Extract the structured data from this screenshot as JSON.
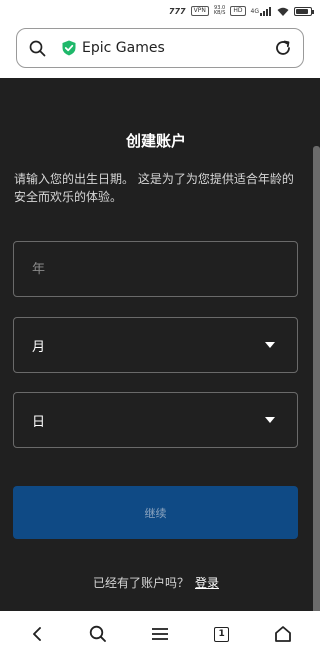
{
  "status_bar": {
    "carrier_glyph": "777",
    "vpn": "VPN",
    "speed_value": "93.0",
    "speed_unit": "KB/S",
    "hd": "HD",
    "network": "4G"
  },
  "address_bar": {
    "site_name": "Epic Games",
    "secure_color": "#1fb86a"
  },
  "form": {
    "title": "创建账户",
    "description": "请输入您的出生日期。 这是为了为您提供适合年龄的安全而欢乐的体验。",
    "year_placeholder": "年",
    "month_label": "月",
    "day_label": "日",
    "continue_label": "继续",
    "login_prompt": "已经有了账户吗？",
    "login_link": "登录"
  },
  "navbar": {
    "tab_count": "1"
  },
  "colors": {
    "page_bg": "#202020",
    "button_bg": "#0f4a85"
  },
  "battery_level_percent": 85
}
